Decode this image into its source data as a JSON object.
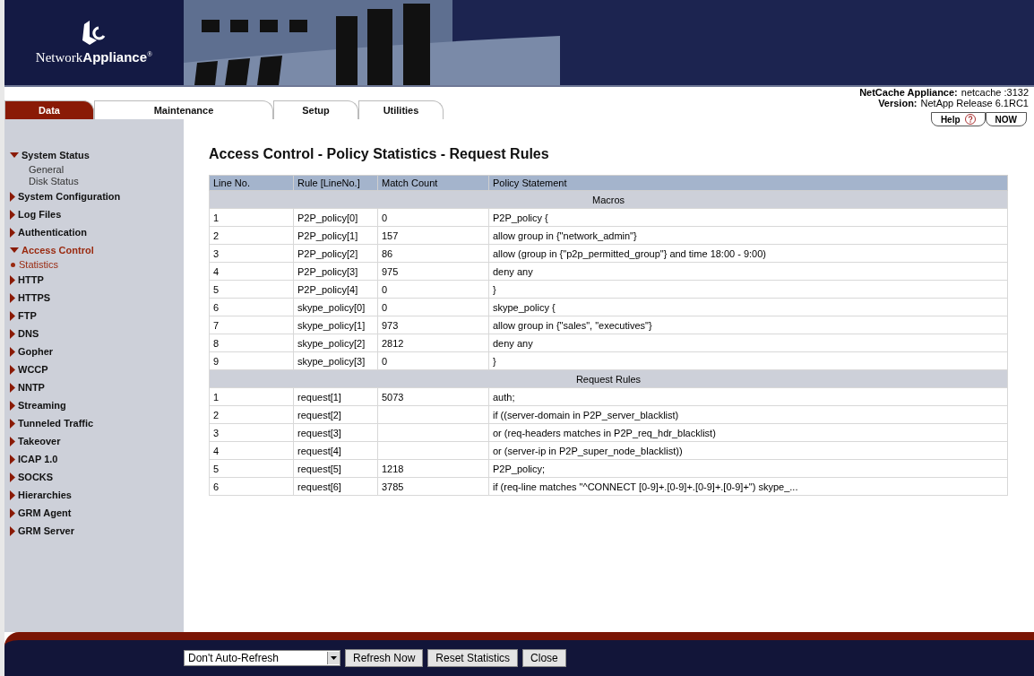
{
  "logo": {
    "text": "Network**Appliance**$^{®}$"
  },
  "tabs": [
    {
      "label": "Data",
      "selected": true
    },
    {
      "label": "Maintenance",
      "selected": false
    },
    {
      "label": "Setup",
      "selected": false
    },
    {
      "label": "Utilities",
      "selected": false
    }
  ],
  "appliance_info": [
    {
      "label": "NetCache Appliance:",
      "value": "netcache :3132"
    },
    {
      "label": "Version:",
      "value": "NetApp Release 6.1RC1"
    }
  ],
  "help_buttons": [
    {
      "label": "Help",
      "kind": "help"
    },
    {
      "label": "NOW",
      "kind": "plain"
    }
  ],
  "sidebar": {
    "items": [
      {
        "label": "System Status",
        "expanded": true,
        "selected": false,
        "children": [
          {
            "label": "General",
            "selected": false
          },
          {
            "label": "Disk Status",
            "selected": false
          }
        ]
      },
      {
        "label": "System Configuration",
        "expanded": false,
        "selected": false
      },
      {
        "label": "Log Files",
        "expanded": false,
        "selected": false
      },
      {
        "label": "Authentication",
        "expanded": false,
        "selected": false
      },
      {
        "label": "Access Control",
        "expanded": true,
        "selected": true,
        "children": [
          {
            "label": "Statistics",
            "selected": true
          }
        ]
      },
      {
        "label": "HTTP",
        "expanded": false,
        "selected": false
      },
      {
        "label": "HTTPS",
        "expanded": false,
        "selected": false
      },
      {
        "label": "FTP",
        "expanded": false,
        "selected": false
      },
      {
        "label": "DNS",
        "expanded": false,
        "selected": false
      },
      {
        "label": "Gopher",
        "expanded": false,
        "selected": false
      },
      {
        "label": "WCCP",
        "expanded": false,
        "selected": false
      },
      {
        "label": "NNTP",
        "expanded": false,
        "selected": false
      },
      {
        "label": "Streaming",
        "expanded": false,
        "selected": false
      },
      {
        "label": "Tunneled Traffic",
        "expanded": false,
        "selected": false
      },
      {
        "label": "Takeover",
        "expanded": false,
        "selected": false
      },
      {
        "label": "ICAP 1.0",
        "expanded": false,
        "selected": false
      },
      {
        "label": "SOCKS",
        "expanded": false,
        "selected": false
      },
      {
        "label": "Hierarchies",
        "expanded": false,
        "selected": false
      },
      {
        "label": "GRM Agent",
        "expanded": false,
        "selected": false
      },
      {
        "label": "GRM Server",
        "expanded": false,
        "selected": false
      }
    ]
  },
  "page_title": "Access Control - Policy Statistics - Request Rules",
  "table": {
    "columns": [
      "Line No.",
      "Rule [LineNo.]",
      "Match Count",
      "Policy Statement"
    ],
    "groups": [
      {
        "title": "Macros",
        "rows": [
          [
            "1",
            "P2P_policy[0]",
            "0",
            "P2P_policy {"
          ],
          [
            "2",
            "P2P_policy[1]",
            "157",
            "allow group in {\"network_admin\"}"
          ],
          [
            "3",
            "P2P_policy[2]",
            "86",
            "allow (group in {\"p2p_permitted_group\"} and time 18:00 - 9:00)"
          ],
          [
            "4",
            "P2P_policy[3]",
            "975",
            "deny any"
          ],
          [
            "5",
            "P2P_policy[4]",
            "0",
            "}"
          ],
          [
            "6",
            "skype_policy[0]",
            "0",
            "skype_policy {"
          ],
          [
            "7",
            "skype_policy[1]",
            "973",
            "allow group in {\"sales\", \"executives\"}"
          ],
          [
            "8",
            "skype_policy[2]",
            "2812",
            "deny any"
          ],
          [
            "9",
            "skype_policy[3]",
            "0",
            "}"
          ]
        ]
      },
      {
        "title": "Request Rules",
        "rows": [
          [
            "1",
            "request[1]",
            "5073",
            "auth;"
          ],
          [
            "2",
            "request[2]",
            "",
            "if ((server-domain in P2P_server_blacklist)"
          ],
          [
            "3",
            "request[3]",
            "",
            "or (req-headers matches in P2P_req_hdr_blacklist)"
          ],
          [
            "4",
            "request[4]",
            "",
            "or (server-ip in P2P_super_node_blacklist))"
          ],
          [
            "5",
            "request[5]",
            "1218",
            "P2P_policy;"
          ],
          [
            "6",
            "request[6]",
            "3785",
            "if (req-line matches \"^CONNECT [0-9]+.[0-9]+.[0-9]+.[0-9]+\") skype_..."
          ]
        ]
      }
    ]
  },
  "footer": {
    "refresh_select": {
      "value": "Don't Auto-Refresh"
    },
    "buttons": [
      "Refresh Now",
      "Reset Statistics",
      "Close"
    ]
  }
}
